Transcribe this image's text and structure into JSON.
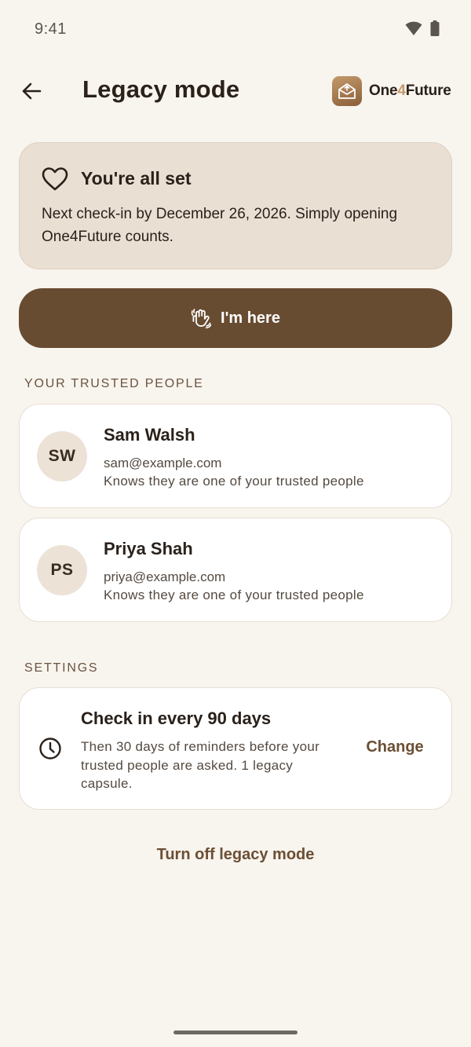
{
  "status_bar": {
    "time": "9:41",
    "icons": [
      "wifi-icon",
      "battery-icon"
    ]
  },
  "app_bar": {
    "title": "Legacy mode",
    "back_icon": "arrow-left-icon",
    "brand": {
      "name_prefix": "One",
      "name_accent": "4",
      "name_suffix": "Future",
      "logo_icon": "envelope-logo-icon"
    }
  },
  "status_card": {
    "icon": "heart-icon",
    "title": "You're all set",
    "body": "Next check-in by December 26, 2026. Simply opening One4Future counts."
  },
  "checkin_button": {
    "label": "I'm here",
    "icon": "waving-hand-icon"
  },
  "trusted_people": {
    "label": "YOUR TRUSTED PEOPLE",
    "people": [
      {
        "initials": "SW",
        "name": "Sam Walsh",
        "email": "sam@example.com",
        "status": "Knows they are one of your trusted people"
      },
      {
        "initials": "PS",
        "name": "Priya Shah",
        "email": "priya@example.com",
        "status": "Knows they are one of your trusted people"
      }
    ]
  },
  "settings": {
    "label": "SETTINGS",
    "icon": "clock-icon",
    "title": "Check in every 90 days",
    "description": "Then 30 days of reminders before your trusted people are asked. 1 legacy capsule.",
    "change_label": "Change"
  },
  "turn_off_label": "Turn off legacy mode",
  "colors": {
    "background": "#F8F4EE",
    "status_card": "#E9DFD3",
    "primary": "#684C31",
    "accent_text": "#6B4F34",
    "avatar_bg": "#ECE2D6",
    "brand_accent": "#C49A6C"
  }
}
